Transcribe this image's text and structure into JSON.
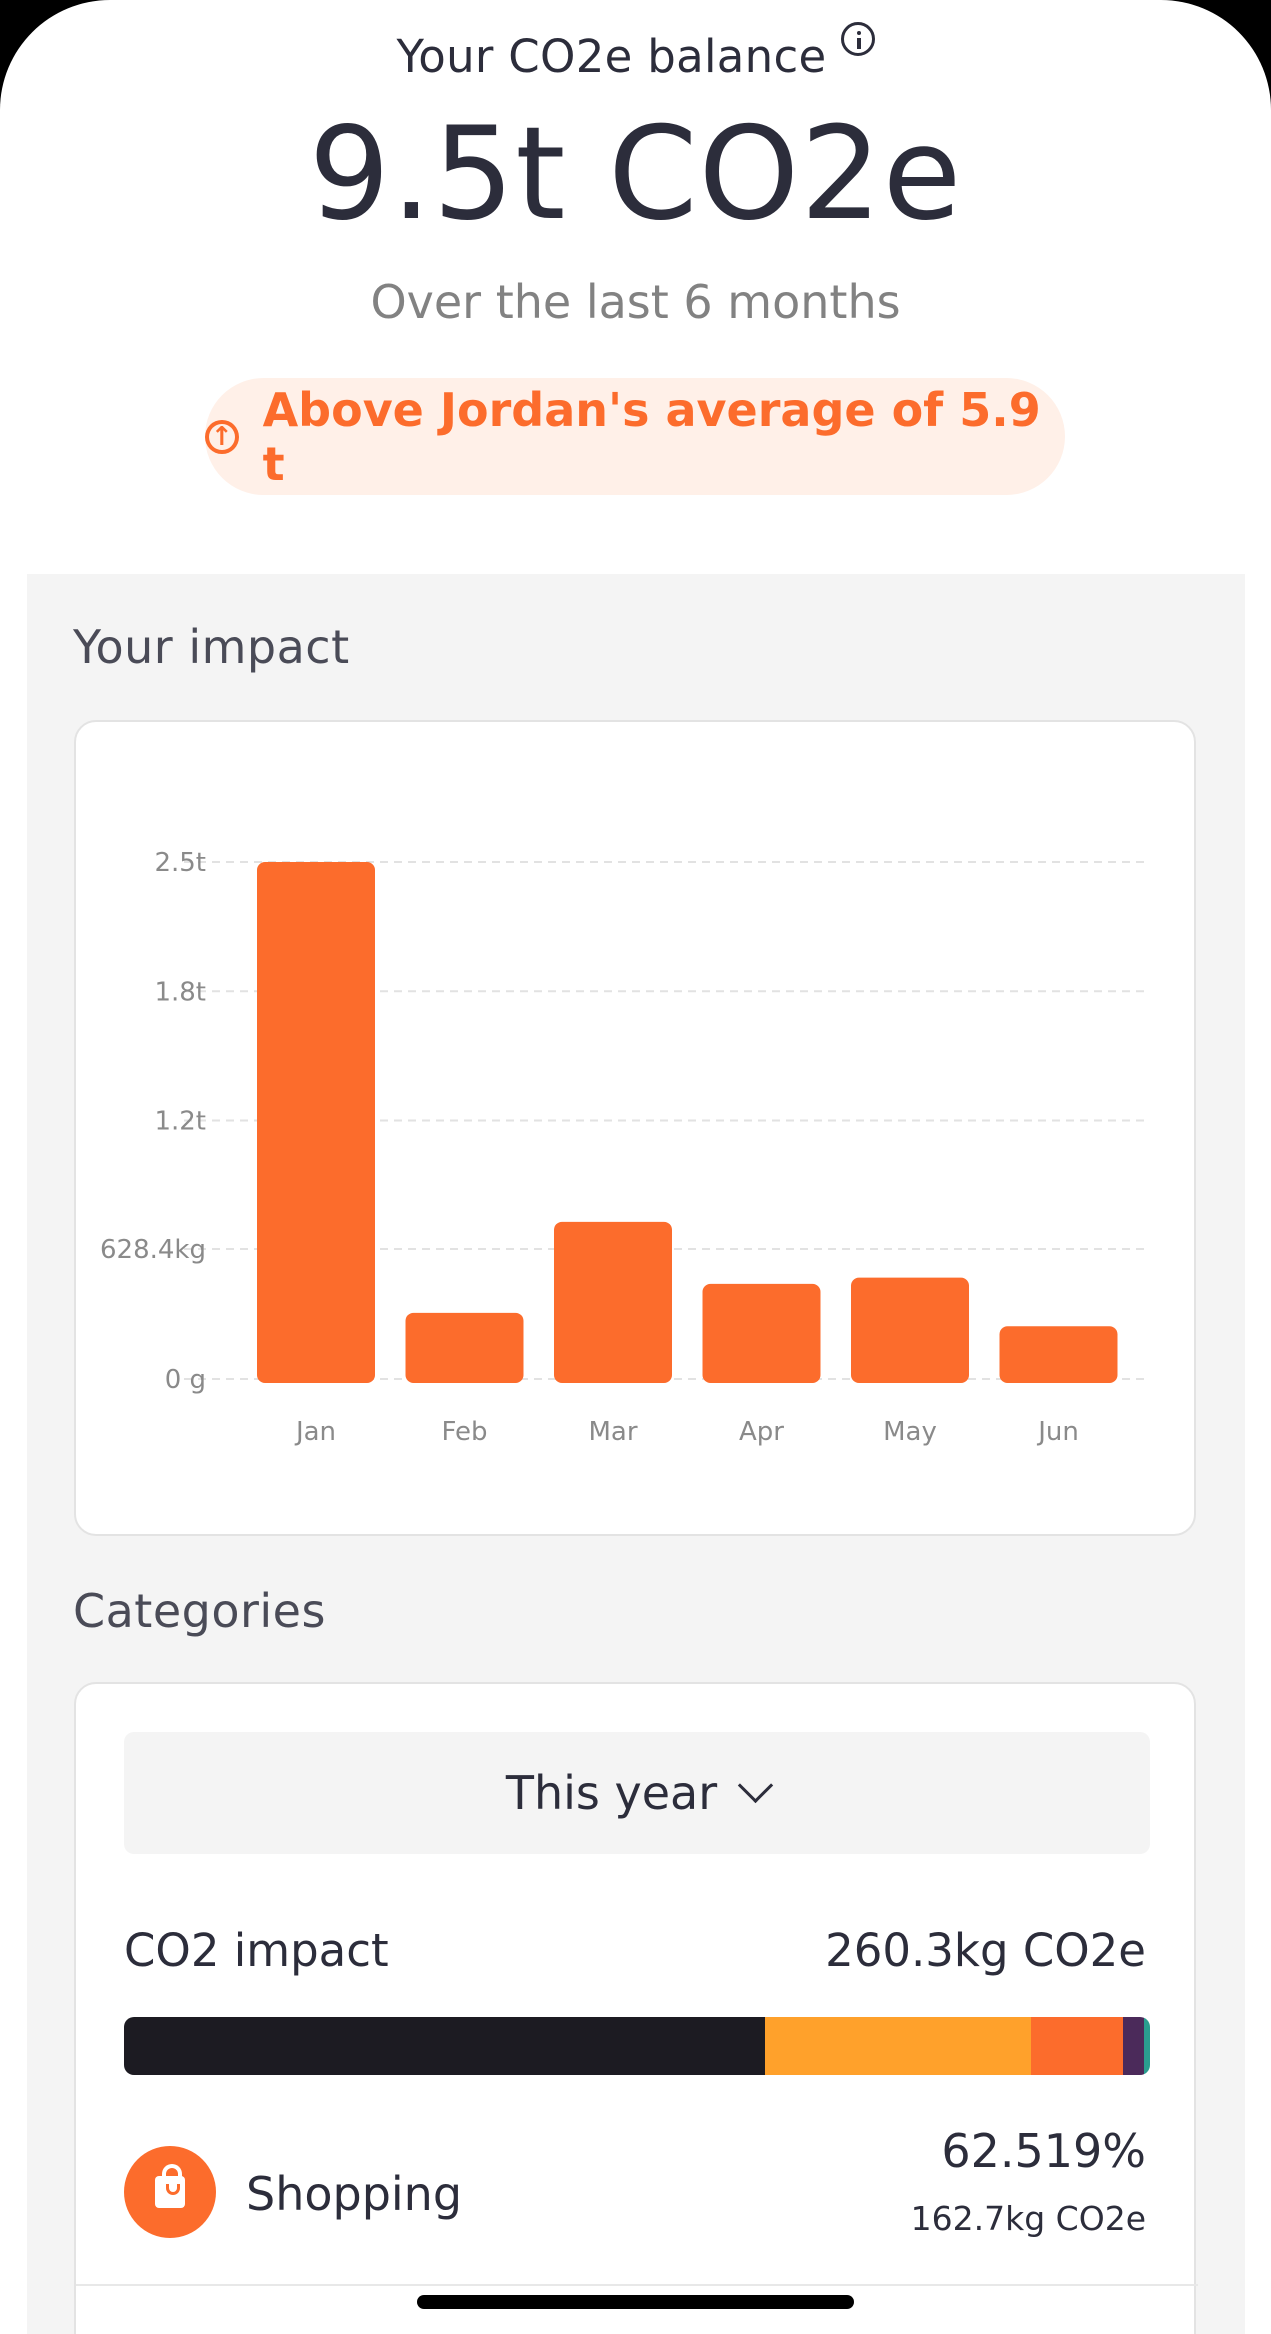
{
  "header": {
    "title": "Your CO2e balance",
    "value": "9.5t CO2e",
    "period": "Over the last 6 months",
    "comparison": "Above Jordan's average of 5.9 t"
  },
  "impact_section": {
    "title": "Your  impact"
  },
  "chart_data": {
    "type": "bar",
    "categories": [
      "Jan",
      "Feb",
      "Mar",
      "Apr",
      "May",
      "Jun"
    ],
    "values": [
      2500,
      320,
      760,
      460,
      490,
      255
    ],
    "unit": "kg",
    "y_ticks": [
      {
        "value": 0,
        "label": "0 g"
      },
      {
        "value": 628.4,
        "label": "628.4kg"
      },
      {
        "value": 1250,
        "label": "1.2t"
      },
      {
        "value": 1875,
        "label": "1.8t"
      },
      {
        "value": 2500,
        "label": "2.5t"
      }
    ],
    "ylim": [
      0,
      2500
    ],
    "grid": true,
    "bar_color": "#fc6c2c"
  },
  "categories_section": {
    "title": "Categories",
    "period_select": "This year",
    "impact_label": "CO2 impact",
    "impact_value": "260.3kg CO2e",
    "breakdown": [
      {
        "color": "#1c1b22",
        "share": 62.519
      },
      {
        "color": "#ffa12b",
        "share": 25.9
      },
      {
        "color": "#fc6c2c",
        "share": 9.0
      },
      {
        "color": "#4b2a5a",
        "share": 2.0
      },
      {
        "color": "#2a9d8f",
        "share": 0.6
      }
    ],
    "items": [
      {
        "name": "Shopping",
        "percent": "62.519%",
        "amount": "162.7kg CO2e",
        "icon": "shopping-bag-icon"
      }
    ]
  },
  "colors": {
    "accent": "#fc6c2c",
    "accent_bg": "#fff0e8",
    "text": "#2c2d3b"
  }
}
